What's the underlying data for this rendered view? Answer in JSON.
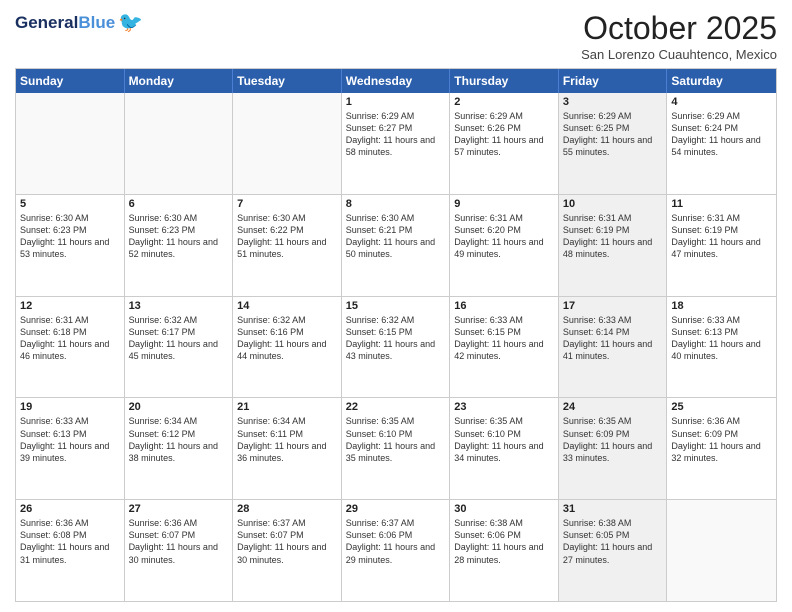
{
  "header": {
    "logo_general": "General",
    "logo_blue": "Blue",
    "month_title": "October 2025",
    "subtitle": "San Lorenzo Cuauhtenco, Mexico"
  },
  "days_of_week": [
    "Sunday",
    "Monday",
    "Tuesday",
    "Wednesday",
    "Thursday",
    "Friday",
    "Saturday"
  ],
  "weeks": [
    [
      {
        "day": "",
        "sunrise": "",
        "sunset": "",
        "daylight": "",
        "empty": true
      },
      {
        "day": "",
        "sunrise": "",
        "sunset": "",
        "daylight": "",
        "empty": true
      },
      {
        "day": "",
        "sunrise": "",
        "sunset": "",
        "daylight": "",
        "empty": true
      },
      {
        "day": "1",
        "sunrise": "Sunrise: 6:29 AM",
        "sunset": "Sunset: 6:27 PM",
        "daylight": "Daylight: 11 hours and 58 minutes.",
        "empty": false
      },
      {
        "day": "2",
        "sunrise": "Sunrise: 6:29 AM",
        "sunset": "Sunset: 6:26 PM",
        "daylight": "Daylight: 11 hours and 57 minutes.",
        "empty": false
      },
      {
        "day": "3",
        "sunrise": "Sunrise: 6:29 AM",
        "sunset": "Sunset: 6:25 PM",
        "daylight": "Daylight: 11 hours and 55 minutes.",
        "empty": false,
        "shaded": true
      },
      {
        "day": "4",
        "sunrise": "Sunrise: 6:29 AM",
        "sunset": "Sunset: 6:24 PM",
        "daylight": "Daylight: 11 hours and 54 minutes.",
        "empty": false
      }
    ],
    [
      {
        "day": "5",
        "sunrise": "Sunrise: 6:30 AM",
        "sunset": "Sunset: 6:23 PM",
        "daylight": "Daylight: 11 hours and 53 minutes.",
        "empty": false
      },
      {
        "day": "6",
        "sunrise": "Sunrise: 6:30 AM",
        "sunset": "Sunset: 6:23 PM",
        "daylight": "Daylight: 11 hours and 52 minutes.",
        "empty": false
      },
      {
        "day": "7",
        "sunrise": "Sunrise: 6:30 AM",
        "sunset": "Sunset: 6:22 PM",
        "daylight": "Daylight: 11 hours and 51 minutes.",
        "empty": false
      },
      {
        "day": "8",
        "sunrise": "Sunrise: 6:30 AM",
        "sunset": "Sunset: 6:21 PM",
        "daylight": "Daylight: 11 hours and 50 minutes.",
        "empty": false
      },
      {
        "day": "9",
        "sunrise": "Sunrise: 6:31 AM",
        "sunset": "Sunset: 6:20 PM",
        "daylight": "Daylight: 11 hours and 49 minutes.",
        "empty": false
      },
      {
        "day": "10",
        "sunrise": "Sunrise: 6:31 AM",
        "sunset": "Sunset: 6:19 PM",
        "daylight": "Daylight: 11 hours and 48 minutes.",
        "empty": false,
        "shaded": true
      },
      {
        "day": "11",
        "sunrise": "Sunrise: 6:31 AM",
        "sunset": "Sunset: 6:19 PM",
        "daylight": "Daylight: 11 hours and 47 minutes.",
        "empty": false
      }
    ],
    [
      {
        "day": "12",
        "sunrise": "Sunrise: 6:31 AM",
        "sunset": "Sunset: 6:18 PM",
        "daylight": "Daylight: 11 hours and 46 minutes.",
        "empty": false
      },
      {
        "day": "13",
        "sunrise": "Sunrise: 6:32 AM",
        "sunset": "Sunset: 6:17 PM",
        "daylight": "Daylight: 11 hours and 45 minutes.",
        "empty": false
      },
      {
        "day": "14",
        "sunrise": "Sunrise: 6:32 AM",
        "sunset": "Sunset: 6:16 PM",
        "daylight": "Daylight: 11 hours and 44 minutes.",
        "empty": false
      },
      {
        "day": "15",
        "sunrise": "Sunrise: 6:32 AM",
        "sunset": "Sunset: 6:15 PM",
        "daylight": "Daylight: 11 hours and 43 minutes.",
        "empty": false
      },
      {
        "day": "16",
        "sunrise": "Sunrise: 6:33 AM",
        "sunset": "Sunset: 6:15 PM",
        "daylight": "Daylight: 11 hours and 42 minutes.",
        "empty": false
      },
      {
        "day": "17",
        "sunrise": "Sunrise: 6:33 AM",
        "sunset": "Sunset: 6:14 PM",
        "daylight": "Daylight: 11 hours and 41 minutes.",
        "empty": false,
        "shaded": true
      },
      {
        "day": "18",
        "sunrise": "Sunrise: 6:33 AM",
        "sunset": "Sunset: 6:13 PM",
        "daylight": "Daylight: 11 hours and 40 minutes.",
        "empty": false
      }
    ],
    [
      {
        "day": "19",
        "sunrise": "Sunrise: 6:33 AM",
        "sunset": "Sunset: 6:13 PM",
        "daylight": "Daylight: 11 hours and 39 minutes.",
        "empty": false
      },
      {
        "day": "20",
        "sunrise": "Sunrise: 6:34 AM",
        "sunset": "Sunset: 6:12 PM",
        "daylight": "Daylight: 11 hours and 38 minutes.",
        "empty": false
      },
      {
        "day": "21",
        "sunrise": "Sunrise: 6:34 AM",
        "sunset": "Sunset: 6:11 PM",
        "daylight": "Daylight: 11 hours and 36 minutes.",
        "empty": false
      },
      {
        "day": "22",
        "sunrise": "Sunrise: 6:35 AM",
        "sunset": "Sunset: 6:10 PM",
        "daylight": "Daylight: 11 hours and 35 minutes.",
        "empty": false
      },
      {
        "day": "23",
        "sunrise": "Sunrise: 6:35 AM",
        "sunset": "Sunset: 6:10 PM",
        "daylight": "Daylight: 11 hours and 34 minutes.",
        "empty": false
      },
      {
        "day": "24",
        "sunrise": "Sunrise: 6:35 AM",
        "sunset": "Sunset: 6:09 PM",
        "daylight": "Daylight: 11 hours and 33 minutes.",
        "empty": false,
        "shaded": true
      },
      {
        "day": "25",
        "sunrise": "Sunrise: 6:36 AM",
        "sunset": "Sunset: 6:09 PM",
        "daylight": "Daylight: 11 hours and 32 minutes.",
        "empty": false
      }
    ],
    [
      {
        "day": "26",
        "sunrise": "Sunrise: 6:36 AM",
        "sunset": "Sunset: 6:08 PM",
        "daylight": "Daylight: 11 hours and 31 minutes.",
        "empty": false
      },
      {
        "day": "27",
        "sunrise": "Sunrise: 6:36 AM",
        "sunset": "Sunset: 6:07 PM",
        "daylight": "Daylight: 11 hours and 30 minutes.",
        "empty": false
      },
      {
        "day": "28",
        "sunrise": "Sunrise: 6:37 AM",
        "sunset": "Sunset: 6:07 PM",
        "daylight": "Daylight: 11 hours and 30 minutes.",
        "empty": false
      },
      {
        "day": "29",
        "sunrise": "Sunrise: 6:37 AM",
        "sunset": "Sunset: 6:06 PM",
        "daylight": "Daylight: 11 hours and 29 minutes.",
        "empty": false
      },
      {
        "day": "30",
        "sunrise": "Sunrise: 6:38 AM",
        "sunset": "Sunset: 6:06 PM",
        "daylight": "Daylight: 11 hours and 28 minutes.",
        "empty": false
      },
      {
        "day": "31",
        "sunrise": "Sunrise: 6:38 AM",
        "sunset": "Sunset: 6:05 PM",
        "daylight": "Daylight: 11 hours and 27 minutes.",
        "empty": false,
        "shaded": true
      },
      {
        "day": "",
        "sunrise": "",
        "sunset": "",
        "daylight": "",
        "empty": true
      }
    ]
  ]
}
